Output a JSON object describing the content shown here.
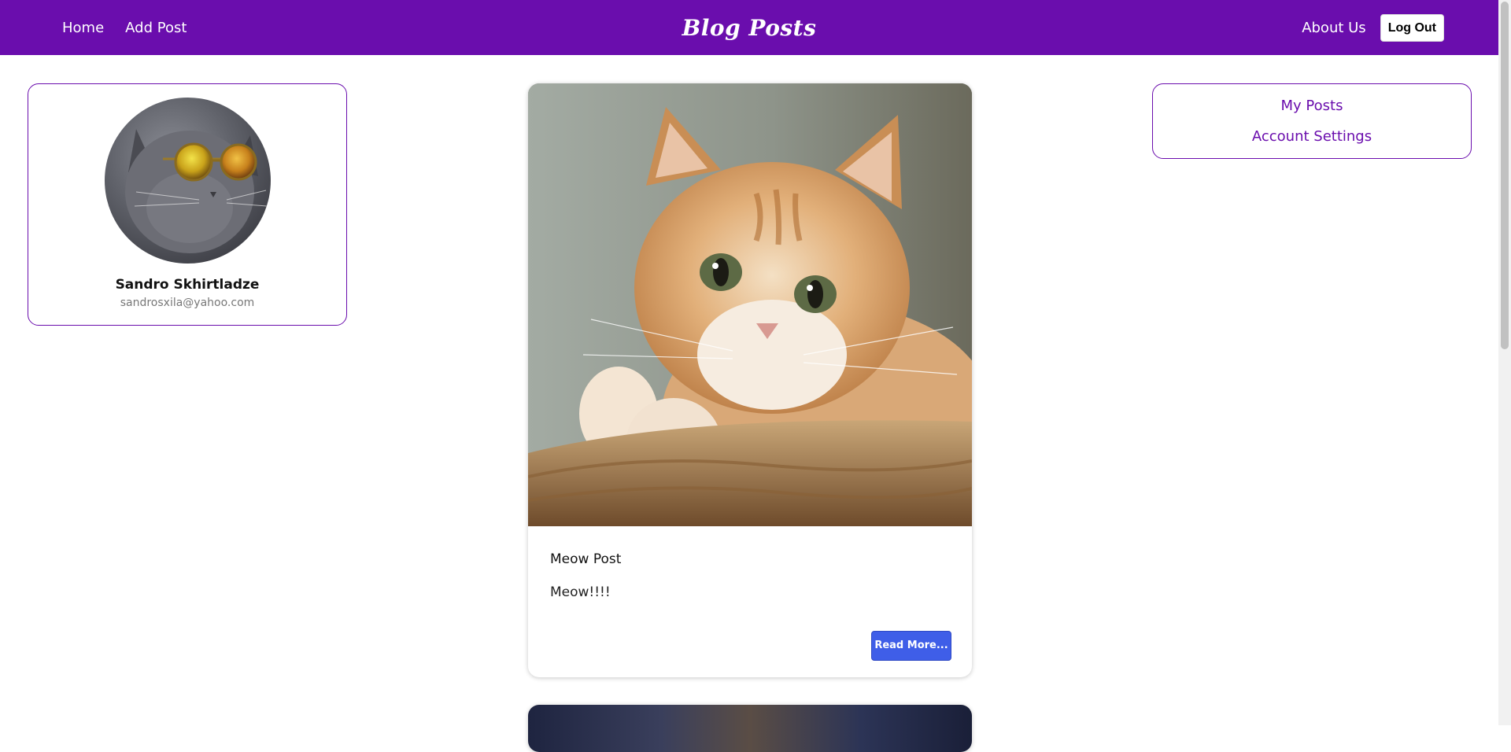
{
  "navbar": {
    "home_label": "Home",
    "add_post_label": "Add Post",
    "title": "Blog Posts",
    "about_label": "About Us",
    "logout_label": "Log Out",
    "bg_color": "#6a0dad"
  },
  "profile": {
    "name": "Sandro Skhirtladze",
    "email": "sandrosxila@yahoo.com",
    "avatar_icon": "cat-with-sunglasses-avatar"
  },
  "posts": [
    {
      "title": "Meow Post",
      "body": "Meow!!!!",
      "read_more_label": "Read More...",
      "image": "ginger-cat-on-basket-photo"
    },
    {
      "image": "second-post-photo-partial"
    }
  ],
  "menu": {
    "items": [
      {
        "label": "My Posts"
      },
      {
        "label": "Account Settings"
      }
    ]
  },
  "colors": {
    "accent": "#6a0dad",
    "button_blue": "#3f5ee8"
  }
}
